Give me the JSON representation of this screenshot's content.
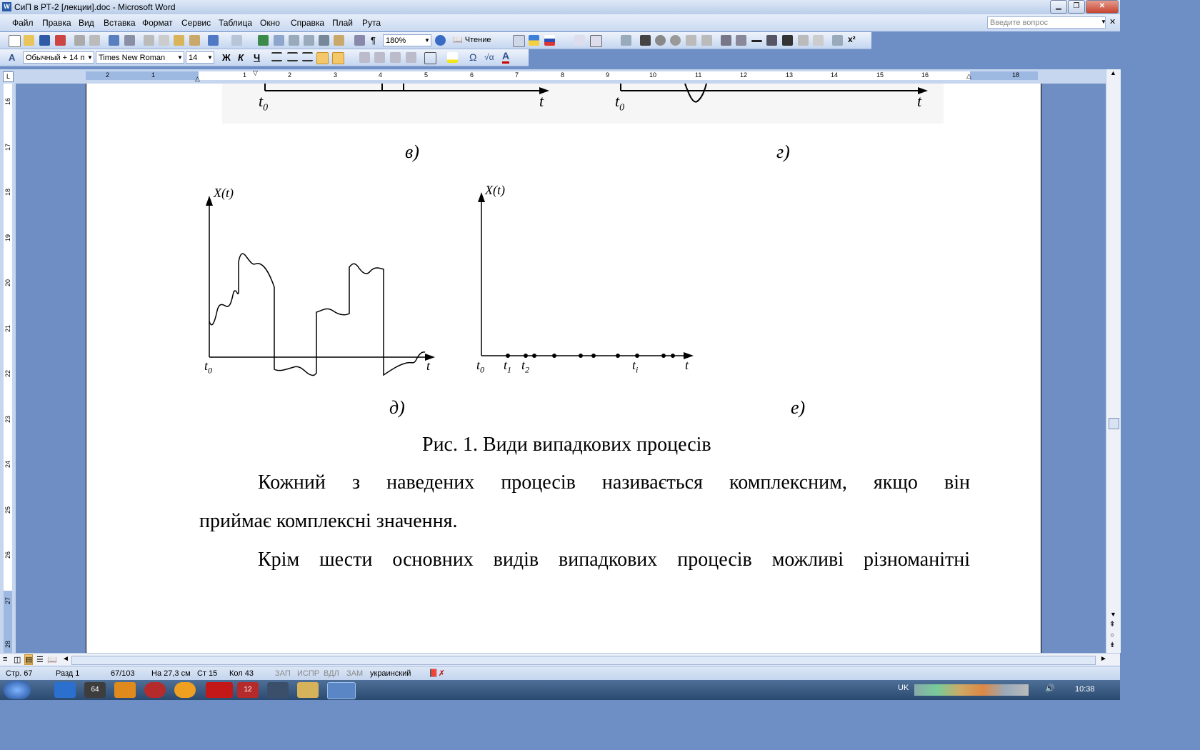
{
  "window": {
    "title": "СиП в РТ-2 [лекции].doc - Microsoft Word",
    "icon": "word-doc-icon"
  },
  "menu": {
    "items": [
      "Файл",
      "Правка",
      "Вид",
      "Вставка",
      "Формат",
      "Сервис",
      "Таблица",
      "Окно",
      "Справка",
      "Плай",
      "Рута"
    ],
    "help_placeholder": "Введите вопрос"
  },
  "toolbar": {
    "zoom": "180%",
    "reading_label": "Чтение"
  },
  "format": {
    "style": "Обычный + 14 п",
    "font": "Times New Roman",
    "size": "14",
    "bold_glyph": "Ж",
    "italic_glyph": "К",
    "underline_glyph": "Ч"
  },
  "ruler": {
    "h_numbers": [
      "2",
      "1",
      "1",
      "2",
      "3",
      "4",
      "5",
      "6",
      "7",
      "8",
      "9",
      "10",
      "11",
      "12",
      "13",
      "14",
      "15",
      "16",
      "18"
    ],
    "v_numbers": [
      "16",
      "17",
      "18",
      "19",
      "20",
      "21",
      "22",
      "23",
      "24",
      "25",
      "26",
      "27",
      "28"
    ]
  },
  "document": {
    "top_labels": {
      "t0_left": "t",
      "t0_sub": "0",
      "t_left": "t",
      "t0_right": "t",
      "t0_right_sub": "0",
      "t_right": "t"
    },
    "captions": {
      "v": "в)",
      "g": "г)",
      "d": "д)",
      "e": "е)"
    },
    "graph_d": {
      "ylabel": "X(t)",
      "t0": "t",
      "t0_sub": "0",
      "t": "t"
    },
    "graph_e": {
      "ylabel": "X(t)",
      "t0": "t",
      "t0_sub": "0",
      "t1": "t",
      "t1_sub": "1",
      "t2": "t",
      "t2_sub": "2",
      "ti": "t",
      "ti_sub": "i",
      "t": "t"
    },
    "figure_caption": "Рис. 1. Види випадкових процесів",
    "para1_line1": "Кожний з наведених процесів називається комплексним, якщо він",
    "para1_line2": "приймає комплексні значення.",
    "para2_line1": "Крім шести основних видів випадкових процесів можливі різноманітні"
  },
  "status": {
    "page": "Стр. 67",
    "section": "Разд 1",
    "pages": "67/103",
    "at": "На 27,3 см",
    "line": "Ст 15",
    "col": "Кол 43",
    "rec": "ЗАП",
    "trk": "ИСПР",
    "ext": "ВДЛ",
    "ovr": "ЗАМ",
    "language": "украинский"
  },
  "taskbar": {
    "lang": "UK",
    "clock": "10:38",
    "badge_64": "64",
    "badge_12": "12"
  }
}
